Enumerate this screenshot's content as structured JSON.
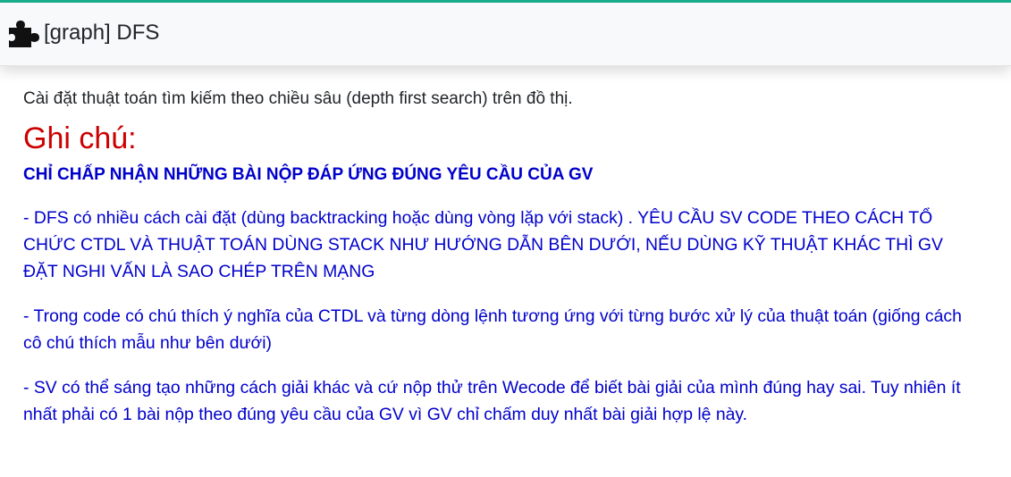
{
  "header": {
    "icon": "puzzle-piece-icon",
    "title": "[graph] DFS"
  },
  "colors": {
    "accent": "#1aaf8f",
    "note_title": "#cc0000",
    "note_text": "#0000cc",
    "body_text": "#212529"
  },
  "problem": {
    "intro": "Cài đặt thuật toán tìm kiếm theo chiều sâu (depth first search) trên đồ thị.",
    "note_title": "Ghi chú:",
    "requirement": "CHỈ CHẤP NHẬN NHỮNG BÀI NỘP ĐÁP ỨNG ĐÚNG YÊU CẦU CỦA GV",
    "notes": [
      "- DFS có nhiều cách cài đặt (dùng backtracking hoặc dùng vòng lặp với stack) . YÊU CẦU SV CODE THEO CÁCH TỔ CHỨC CTDL VÀ THUẬT TOÁN DÙNG STACK NHƯ HƯỚNG DẪN BÊN DƯỚI, NẾU DÙNG KỸ THUẬT KHÁC THÌ GV ĐẶT NGHI VẤN LÀ SAO CHÉP TRÊN MẠNG",
      "- Trong code có chú thích ý nghĩa của CTDL và từng dòng lệnh tương ứng với từng bước xử lý của thuật toán (giống cách cô chú thích mẫu như bên dưới)",
      "- SV có thể sáng tạo những cách giải khác và cứ nộp thử trên Wecode để biết bài giải của mình đúng hay sai. Tuy nhiên ít nhất phải có 1 bài nộp theo đúng yêu cầu của GV vì GV chỉ chấm duy nhất bài giải hợp lệ này."
    ]
  }
}
